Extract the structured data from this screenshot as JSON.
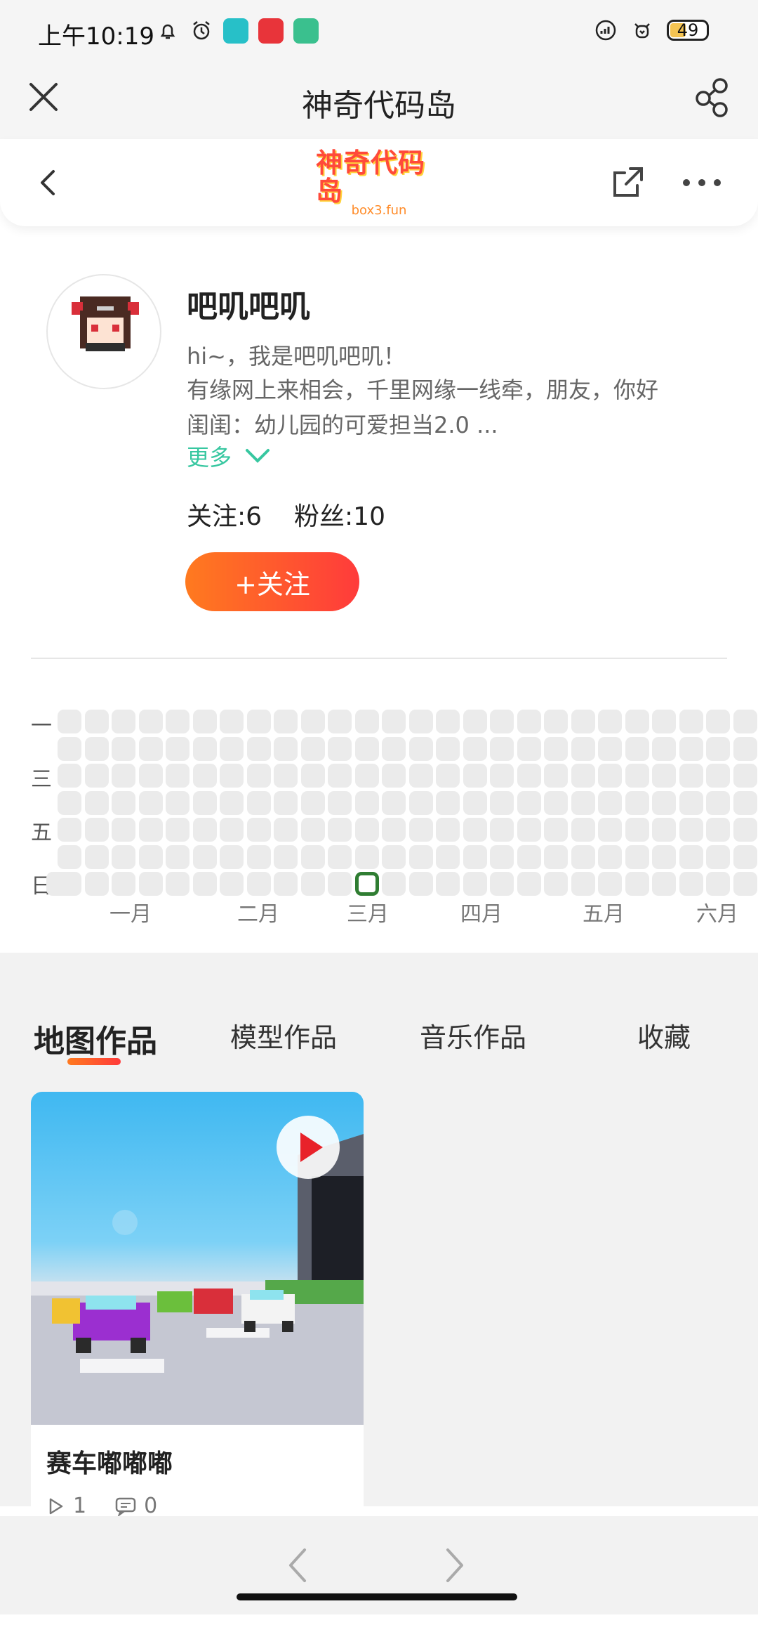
{
  "status_bar": {
    "time": "上午10:19",
    "battery": "49",
    "icons": [
      "notification-bell-icon",
      "alarm-icon",
      "app-icon-teal",
      "app-icon-red",
      "app-icon-shield",
      "signal-icon",
      "wifi-icon"
    ]
  },
  "header": {
    "title": "神奇代码岛"
  },
  "web_nav": {
    "logo_main": "神奇代码岛",
    "logo_sub": "box3.fun"
  },
  "profile": {
    "username": "吧叽吧叽",
    "bio_lines": [
      "hi~，我是吧叽吧叽！",
      "有缘网上来相会，千里网缘一线牵，朋友，你好",
      "闺闺：幼儿园的可爱担当2.0  ..."
    ],
    "more_label": "更多",
    "following": "关注:6",
    "followers": "粉丝:10",
    "follow_button": "+关注"
  },
  "heatmap": {
    "day_labels": [
      "一",
      "三",
      "五",
      "日"
    ],
    "months": [
      "一月",
      "二月",
      "三月",
      "四月",
      "五月",
      "六月"
    ],
    "active_cells": [
      {
        "week": 11,
        "day": 6,
        "count": 1
      }
    ]
  },
  "tabs": [
    {
      "label": "地图作品",
      "active": true
    },
    {
      "label": "模型作品",
      "active": false
    },
    {
      "label": "音乐作品",
      "active": false
    },
    {
      "label": "收藏",
      "active": false
    }
  ],
  "works": [
    {
      "title": "赛车嘟嘟嘟",
      "plays": "1",
      "comments": "0"
    }
  ],
  "colors": {
    "accent_start": "#ff7a1f",
    "accent_end": "#ff3b3b",
    "link": "#37c7a0",
    "heat_active": "#2f7d32"
  }
}
